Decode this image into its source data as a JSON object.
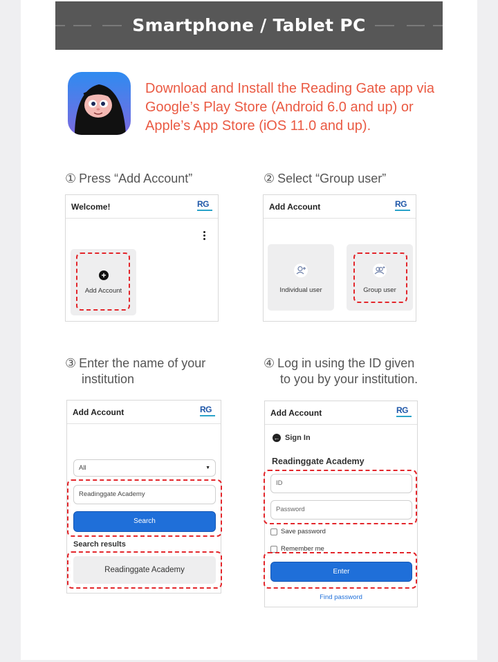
{
  "banner": {
    "title": "Smartphone / Tablet PC"
  },
  "intro": {
    "text": "Download and Install the Reading Gate app via Google’s Play Store (Android 6.0 and up) or Apple’s App Store (iOS 11.0 and up)."
  },
  "steps": [
    {
      "num": "①",
      "label": "Press “Add Account”"
    },
    {
      "num": "②",
      "label": "Select “Group user”"
    },
    {
      "num": "③",
      "line1": "Enter the name of your",
      "line2": "institution"
    },
    {
      "num": "④",
      "line1": "Log in using the ID given",
      "line2": "to you by your institution."
    }
  ],
  "logo": {
    "text": "RG"
  },
  "screen1": {
    "title": "Welcome!",
    "add_account": "Add Account"
  },
  "screen2": {
    "title": "Add Account",
    "individual": "Individual user",
    "group": "Group user"
  },
  "screen3": {
    "title": "Add Account",
    "select_value": "All",
    "search_value": "Readinggate Academy",
    "search_button": "Search",
    "results_heading": "Search results",
    "result_item": "Readinggate Academy"
  },
  "screen4": {
    "title": "Add Account",
    "back_label": "Sign In",
    "academy": "Readinggate Academy",
    "id_placeholder": "ID",
    "password_placeholder": "Password",
    "save_password": "Save password",
    "remember_me": "Remember me",
    "enter_button": "Enter",
    "find_password": "Find password"
  },
  "colors": {
    "accent": "#ea5a43",
    "button": "#1f6fd9",
    "highlight": "#e3262b",
    "banner": "#575757"
  }
}
